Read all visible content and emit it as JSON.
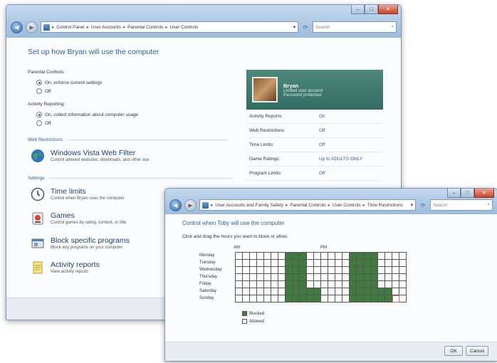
{
  "window1": {
    "breadcrumb": [
      "Control Panel",
      "User Accounts",
      "Parental Controls",
      "User Controls"
    ],
    "search_placeholder": "Search",
    "heading": "Set up how Bryan will use the computer",
    "parental_controls": {
      "label": "Parental Controls:",
      "options": [
        "On, enforce current settings",
        "Off"
      ],
      "selected": 0
    },
    "activity_reporting": {
      "label": "Activity Reporting:",
      "options": [
        "On, collect information about computer usage",
        "Off"
      ],
      "selected": 0
    },
    "web_section": "Web Restrictions",
    "web_filter": {
      "title": "Windows Vista Web Filter",
      "desc": "Control allowed websites, downloads, and other use"
    },
    "settings_section": "Settings",
    "settings": [
      {
        "title": "Time limits",
        "desc": "Control when Bryan uses the computer",
        "icon": "clock-icon"
      },
      {
        "title": "Games",
        "desc": "Control games by rating, content, or title",
        "icon": "games-icon"
      },
      {
        "title": "Block specific programs",
        "desc": "Block any programs on your computer",
        "icon": "programs-icon"
      },
      {
        "title": "Activity reports",
        "desc": "View activity reports",
        "icon": "reports-icon"
      }
    ],
    "user_card": {
      "name": "Bryan",
      "line1": "Limited user account",
      "line2": "Password protected"
    },
    "summary": [
      {
        "key": "Activity Reports:",
        "value": "On"
      },
      {
        "key": "Web Restrictions:",
        "value": "Off"
      },
      {
        "key": "Time Limits:",
        "value": "Off"
      },
      {
        "key": "Game Ratings:",
        "value": "Up to ADULTS ONLY"
      },
      {
        "key": "Program Limits:",
        "value": "Off"
      }
    ]
  },
  "window2": {
    "breadcrumb": [
      "User Accounts and Family Safety",
      "Parental Controls",
      "User Controls",
      "Time Restrictions"
    ],
    "search_placeholder": "Search",
    "heading": "Control when Toby will use the computer",
    "instruction": "Click and drag the hours you want to block or allow.",
    "hour_labels": {
      "am": "AM",
      "pm": "PM"
    },
    "days": [
      "Monday",
      "Tuesday",
      "Wednesday",
      "Thursday",
      "Friday",
      "Saturday",
      "Sunday"
    ],
    "blocked_hours": [
      [
        7,
        8,
        9,
        16,
        17,
        18,
        19
      ],
      [
        7,
        8,
        9,
        16,
        17,
        18,
        19
      ],
      [
        7,
        8,
        9,
        16,
        17,
        18,
        19
      ],
      [
        7,
        8,
        9,
        16,
        17,
        18,
        19
      ],
      [
        7,
        8,
        9,
        16,
        17,
        18,
        19
      ],
      [
        7,
        8,
        9,
        10,
        11,
        16,
        17,
        18,
        19,
        20,
        21
      ],
      [
        7,
        8,
        9,
        10,
        11,
        16,
        17,
        18,
        19,
        20,
        21
      ]
    ],
    "legend": {
      "blocked": "Blocked",
      "allowed": "Allowed"
    },
    "ok_label": "OK",
    "cancel_label": "Cancel",
    "colors": {
      "blocked": "#3f7b3f",
      "allowed": "#ffffff"
    }
  }
}
